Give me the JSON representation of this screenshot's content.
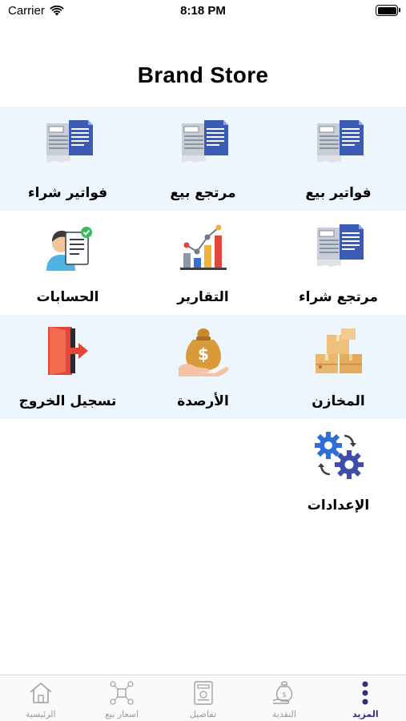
{
  "status": {
    "carrier": "Carrier",
    "time": "8:18 PM"
  },
  "header": {
    "title": "Brand Store"
  },
  "menu": [
    {
      "label": "فواتير بيع",
      "icon": "document-icon"
    },
    {
      "label": "مرتجع بيع",
      "icon": "document-icon"
    },
    {
      "label": "فواتير شراء",
      "icon": "document-icon"
    },
    {
      "label": "مرتجع شراء",
      "icon": "document-icon"
    },
    {
      "label": "التقارير",
      "icon": "chart-icon"
    },
    {
      "label": "الحسابات",
      "icon": "accountant-icon"
    },
    {
      "label": "المخازن",
      "icon": "boxes-icon"
    },
    {
      "label": "الأرصدة",
      "icon": "money-bag-icon"
    },
    {
      "label": "تسجيل الخروج",
      "icon": "logout-icon"
    },
    {
      "label": "الإعدادات",
      "icon": "gears-icon"
    }
  ],
  "tabbar": [
    {
      "label": "المزيد",
      "icon": "more-dots-icon",
      "active": true
    },
    {
      "label": "النقدية",
      "icon": "cash-icon",
      "active": false
    },
    {
      "label": "تفاصيل",
      "icon": "details-icon",
      "active": false
    },
    {
      "label": "اسعار بيع",
      "icon": "prices-icon",
      "active": false
    },
    {
      "label": "الرئيسية",
      "icon": "home-icon",
      "active": false
    }
  ],
  "colors": {
    "accent": "#2f2f7a",
    "row_shade": "#eef6fd",
    "inactive": "#9a9a9a"
  }
}
